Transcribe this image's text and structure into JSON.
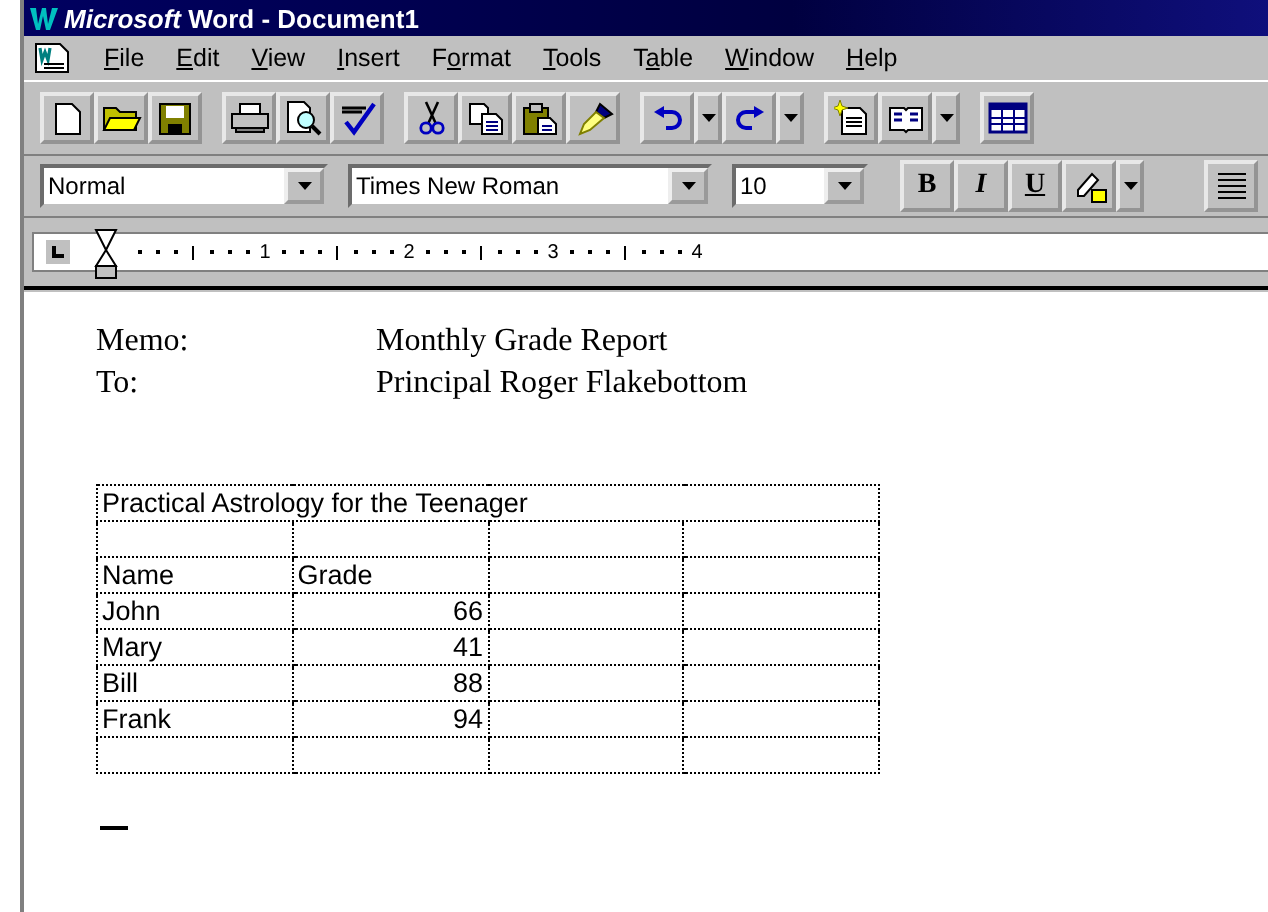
{
  "window": {
    "title": "*Microsoft* Word - Document1"
  },
  "menu": [
    {
      "access_key": "F",
      "after": "ile"
    },
    {
      "access_key": "E",
      "after": "dit"
    },
    {
      "access_key": "V",
      "after": "iew"
    },
    {
      "access_key": "I",
      "after": "nsert"
    },
    {
      "before": "F",
      "access_key": "o",
      "after": "rmat"
    },
    {
      "access_key": "T",
      "after": "ools"
    },
    {
      "before": "T",
      "access_key": "a",
      "after": "ble"
    },
    {
      "access_key": "W",
      "after": "indow"
    },
    {
      "access_key": "H",
      "after": "elp"
    }
  ],
  "formatting": {
    "style": "Normal",
    "font": "Times New Roman",
    "size": "10",
    "bold": "B",
    "italic": "I",
    "underline": "U"
  },
  "ruler": {
    "numbers": [
      "1",
      "2",
      "3",
      "4"
    ]
  },
  "memo": [
    {
      "label": "Memo:",
      "value": "Monthly Grade Report"
    },
    {
      "label": "To:",
      "value": "Principal Roger Flakebottom"
    }
  ],
  "table": {
    "title": "Practical Astrology for the Teenager",
    "rows": [
      [
        "",
        "",
        "",
        ""
      ],
      [
        "Name",
        "Grade",
        "",
        ""
      ],
      [
        "John",
        "66",
        "",
        ""
      ],
      [
        "Mary",
        "41",
        "",
        ""
      ],
      [
        "Bill",
        "88",
        "",
        ""
      ],
      [
        "Frank",
        "94",
        "",
        ""
      ],
      [
        "",
        "",
        "",
        ""
      ]
    ]
  }
}
